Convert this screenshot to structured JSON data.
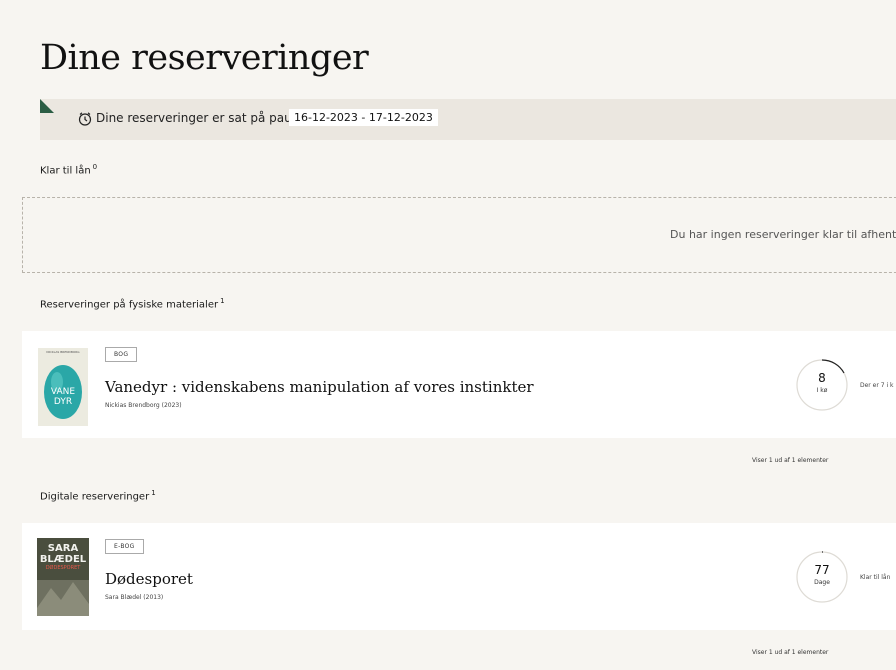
{
  "page": {
    "title": "Dine reserveringer"
  },
  "pause": {
    "text": "Dine reserveringer er sat på pause",
    "dates": "16-12-2023 - 17-12-2023",
    "icon": "clock-pause-icon"
  },
  "sections": {
    "ready": {
      "title": "Klar til lån",
      "count": "0",
      "empty_text": "Du har ingen reserveringer klar til afhentn"
    },
    "physical": {
      "title": "Reserveringer på fysiske materialer",
      "count": "1"
    },
    "digital": {
      "title": "Digitale reserveringer",
      "count": "1"
    }
  },
  "physical_items": [
    {
      "tag": "BOG",
      "title": "Vanedyr : videnskabens manipulation af vores instinkter",
      "meta": "Nickias Brendborg (2023)",
      "counter_value": "8",
      "counter_label": "I kø",
      "status": "Der er 7 i k",
      "cover": {
        "author": "NICKLAS BRENDBORG",
        "line1": "VANE",
        "line2": "DYR"
      }
    }
  ],
  "digital_items": [
    {
      "tag": "E-BOG",
      "title": "Dødesporet",
      "meta": "Sara Blædel (2013)",
      "counter_value": "77",
      "counter_label": "Dage",
      "status": "Klar til lån",
      "cover": {
        "line1": "SARA",
        "line2": "BLÆDEL",
        "line3": "DØDESPORET"
      }
    }
  ],
  "pagination": {
    "physical": "Viser 1 ud af 1 elementer",
    "digital": "Viser 1 ud af 1 elementer"
  },
  "colors": {
    "accent_green": "#2b5d44",
    "banner_bg": "#ebe7e0",
    "page_bg": "#f7f5f1"
  }
}
